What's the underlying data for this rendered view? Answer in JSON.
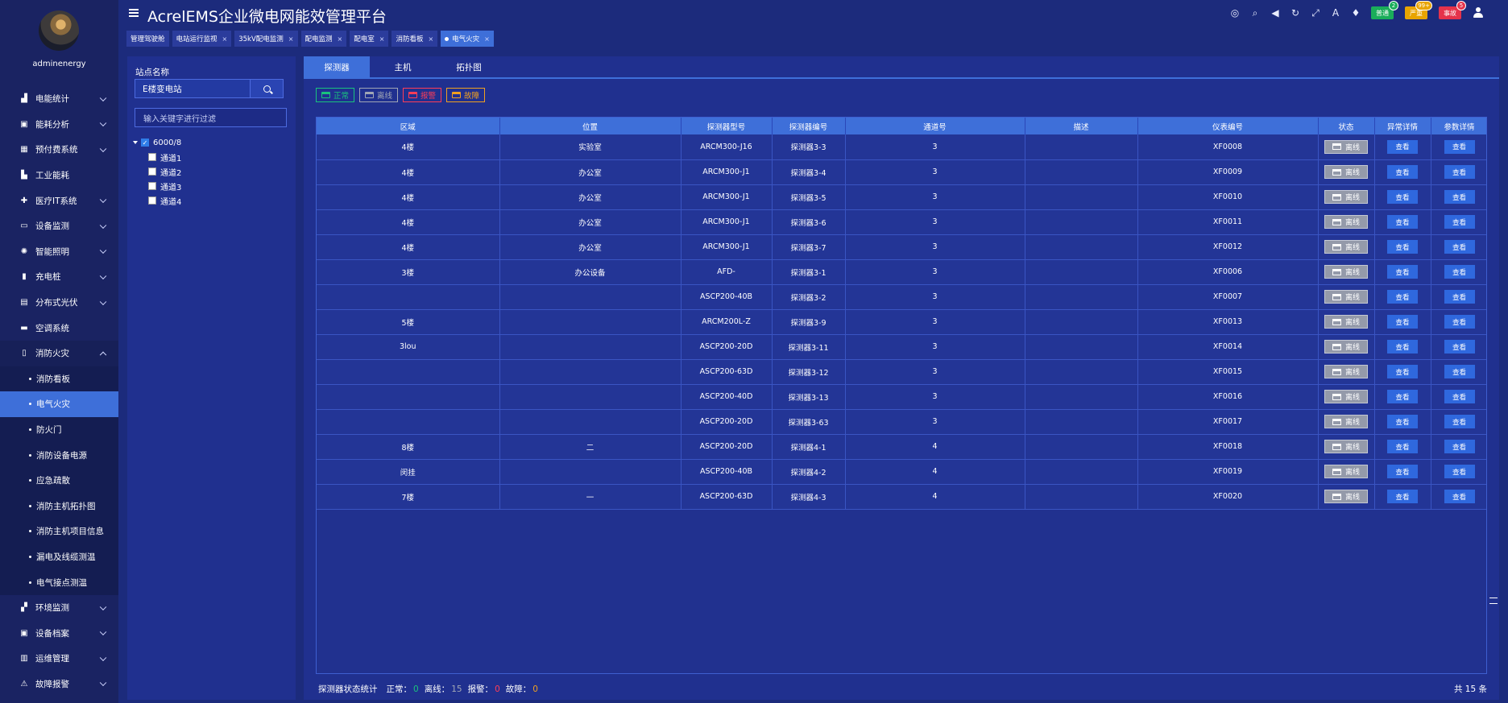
{
  "user": {
    "name": "adminenergy"
  },
  "app": {
    "title": "AcrelEMS企业微电网能效管理平台"
  },
  "header": {
    "badges": [
      {
        "label": "普通",
        "count": "2",
        "color": "#1aad5a"
      },
      {
        "label": "严重",
        "count": "99+",
        "color": "#e8a400"
      },
      {
        "label": "事故",
        "count": "5",
        "color": "#e5334b"
      }
    ]
  },
  "sidebar": {
    "items": [
      {
        "label": "电能统计",
        "icon": "bar-chart-icon",
        "glyph": "▟",
        "arrow": true
      },
      {
        "label": "能耗分析",
        "icon": "picture-icon",
        "glyph": "▣",
        "arrow": true
      },
      {
        "label": "预付费系统",
        "icon": "coin-icon",
        "glyph": "▦",
        "arrow": true
      },
      {
        "label": "工业能耗",
        "icon": "factory-icon",
        "glyph": "▙",
        "arrow": false
      },
      {
        "label": "医疗IT系统",
        "icon": "medical-icon",
        "glyph": "✚",
        "arrow": true
      },
      {
        "label": "设备监测",
        "icon": "monitor-icon",
        "glyph": "▭",
        "arrow": true
      },
      {
        "label": "智能照明",
        "icon": "bulb-icon",
        "glyph": "✺",
        "arrow": true
      },
      {
        "label": "充电桩",
        "icon": "charger-icon",
        "glyph": "▮",
        "arrow": true
      },
      {
        "label": "分布式光伏",
        "icon": "solar-icon",
        "glyph": "▤",
        "arrow": true
      },
      {
        "label": "空调系统",
        "icon": "aircon-icon",
        "glyph": "▬",
        "arrow": false
      }
    ],
    "fire": {
      "label": "消防火灾",
      "icon": "extinguisher-icon",
      "glyph": "▯",
      "children": [
        "消防看板",
        "电气火灾",
        "防火门",
        "消防设备电源",
        "应急疏散",
        "消防主机拓扑图",
        "消防主机项目信息",
        "漏电及线缆测温",
        "电气接点测温"
      ],
      "active_index": 1
    },
    "bottom_items": [
      {
        "label": "环境监测",
        "icon": "environment-icon",
        "glyph": "▞",
        "arrow": true
      },
      {
        "label": "设备档案",
        "icon": "archive-icon",
        "glyph": "▣",
        "arrow": true
      },
      {
        "label": "运维管理",
        "icon": "maintenance-icon",
        "glyph": "▥",
        "arrow": true
      },
      {
        "label": "故障报警",
        "icon": "alarm-icon",
        "glyph": "⚠",
        "arrow": true
      }
    ]
  },
  "tabs": [
    {
      "label": "管理驾驶舱",
      "closable": false,
      "active": false
    },
    {
      "label": "电站运行监视",
      "closable": true,
      "active": false
    },
    {
      "label": "35kV配电监测",
      "closable": true,
      "active": false
    },
    {
      "label": "配电监测",
      "closable": true,
      "active": false
    },
    {
      "label": "配电室",
      "closable": true,
      "active": false
    },
    {
      "label": "消防看板",
      "closable": true,
      "active": false
    },
    {
      "label": "电气火灾",
      "closable": true,
      "active": true
    }
  ],
  "left_panel": {
    "station_label": "站点名称",
    "station_value": "E楼变电站",
    "filter_placeholder": "输入关键字进行过滤",
    "tree": {
      "root": "6000/8",
      "children": [
        "通道1",
        "通道2",
        "通道3",
        "通道4"
      ]
    }
  },
  "main": {
    "tabs": [
      "探测器",
      "主机",
      "拓扑图"
    ],
    "active_tab": 0,
    "legend": [
      {
        "label": "正常",
        "color": "#19c37d"
      },
      {
        "label": "离线",
        "color": "#a0a6b5"
      },
      {
        "label": "报警",
        "color": "#ff3d57"
      },
      {
        "label": "故障",
        "color": "#f0a020"
      }
    ],
    "columns": [
      "区域",
      "位置",
      "探测器型号",
      "探测器编号",
      "通道号",
      "描述",
      "仪表编号",
      "状态",
      "异常详情",
      "参数详情"
    ],
    "status_label": "离线",
    "view_label": "查看",
    "rows": [
      [
        "4楼",
        "实验室",
        "ARCM300-J16",
        "探测器3-3",
        "3",
        "",
        "XF0008"
      ],
      [
        "4楼",
        "办公室",
        "ARCM300-J1",
        "探测器3-4",
        "3",
        "",
        "XF0009"
      ],
      [
        "4楼",
        "办公室",
        "ARCM300-J1",
        "探测器3-5",
        "3",
        "",
        "XF0010"
      ],
      [
        "4楼",
        "办公室",
        "ARCM300-J1",
        "探测器3-6",
        "3",
        "",
        "XF0011"
      ],
      [
        "4楼",
        "办公室",
        "ARCM300-J1",
        "探测器3-7",
        "3",
        "",
        "XF0012"
      ],
      [
        "3楼",
        "办公设备",
        "AFD-",
        "探测器3-1",
        "3",
        "",
        "XF0006"
      ],
      [
        "",
        "",
        "ASCP200-40B",
        "探测器3-2",
        "3",
        "",
        "XF0007"
      ],
      [
        "5楼",
        "",
        "ARCM200L-Z",
        "探测器3-9",
        "3",
        "",
        "XF0013"
      ],
      [
        "3lou",
        "",
        "ASCP200-20D",
        "探测器3-11",
        "3",
        "",
        "XF0014"
      ],
      [
        "",
        "",
        "ASCP200-63D",
        "探测器3-12",
        "3",
        "",
        "XF0015"
      ],
      [
        "",
        "",
        "ASCP200-40D",
        "探测器3-13",
        "3",
        "",
        "XF0016"
      ],
      [
        "",
        "",
        "ASCP200-20D",
        "探测器3-63",
        "3",
        "",
        "XF0017"
      ],
      [
        "8楼",
        "二",
        "ASCP200-20D",
        "探测器4-1",
        "4",
        "",
        "XF0018"
      ],
      [
        "闵挂",
        "",
        "ASCP200-40B",
        "探测器4-2",
        "4",
        "",
        "XF0019"
      ],
      [
        "7楼",
        "一",
        "ASCP200-63D",
        "探测器4-3",
        "4",
        "",
        "XF0020"
      ]
    ],
    "footer": {
      "label": "探测器状态统计",
      "normal_label": "正常：",
      "normal_value": "0",
      "offline_label": "离线：",
      "offline_value": "15",
      "alarm_label": "报警：",
      "alarm_value": "0",
      "fault_label": "故障：",
      "fault_value": "0",
      "total": "共 15 条"
    }
  }
}
